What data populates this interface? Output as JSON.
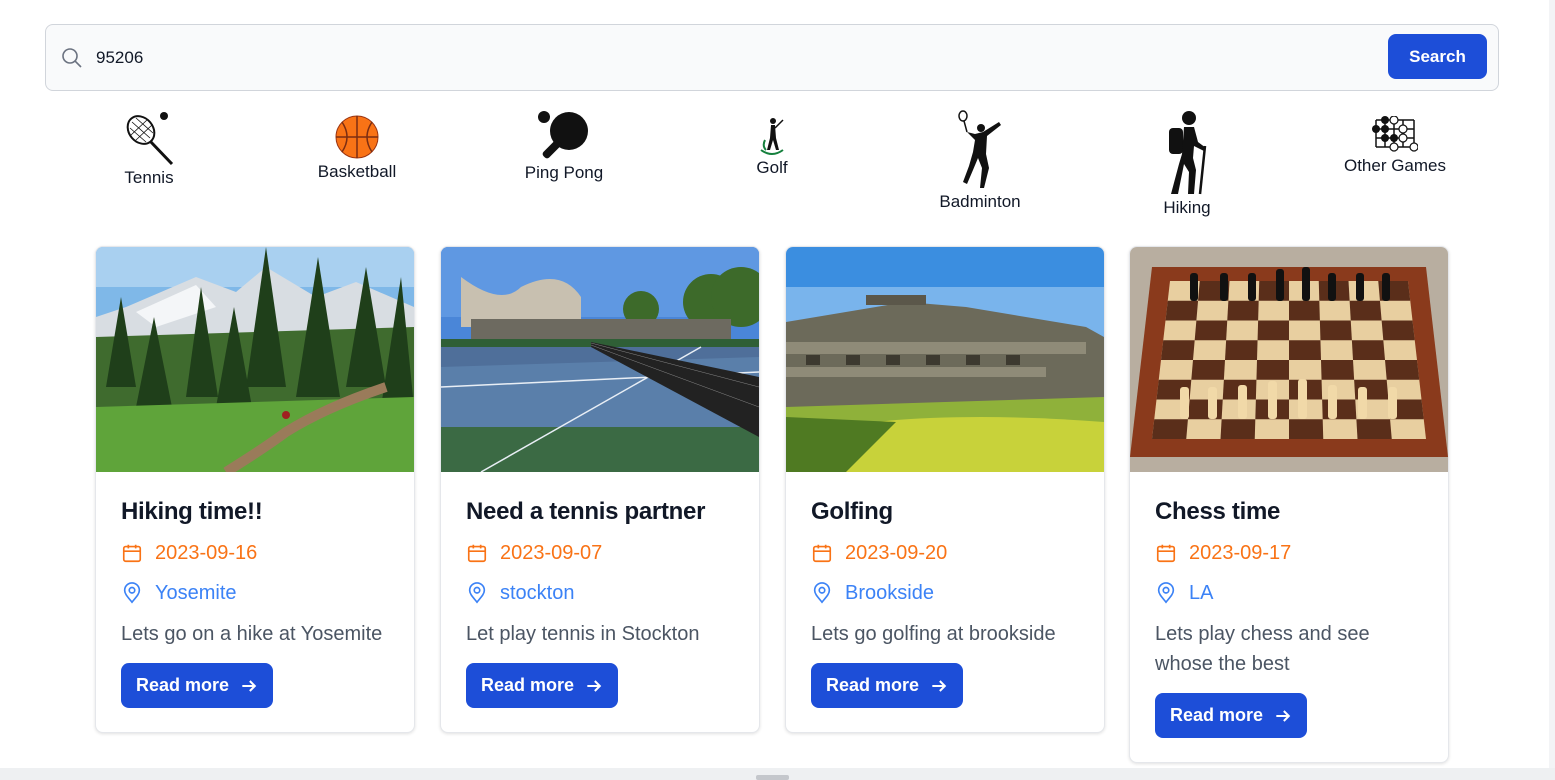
{
  "search": {
    "value": "95206",
    "button_label": "Search"
  },
  "categories": [
    {
      "label": "Tennis",
      "icon": "tennis-racket-icon"
    },
    {
      "label": "Basketball",
      "icon": "basketball-icon"
    },
    {
      "label": "Ping Pong",
      "icon": "ping-pong-paddle-icon"
    },
    {
      "label": "Golf",
      "icon": "golfer-icon"
    },
    {
      "label": "Badminton",
      "icon": "badminton-player-icon"
    },
    {
      "label": "Hiking",
      "icon": "hiker-icon"
    },
    {
      "label": "Other Games",
      "icon": "go-board-icon"
    }
  ],
  "cards": [
    {
      "title": "Hiking time!!",
      "date": "2023-09-16",
      "location": "Yosemite",
      "description": "Lets go on a hike at Yosemite",
      "button_label": "Read more",
      "image": "mountain-trail-photo"
    },
    {
      "title": "Need a tennis partner",
      "date": "2023-09-07",
      "location": "stockton",
      "description": "Let play tennis in Stockton",
      "button_label": "Read more",
      "image": "tennis-court-photo"
    },
    {
      "title": "Golfing",
      "date": "2023-09-20",
      "location": "Brookside",
      "description": "Lets go golfing at brookside",
      "button_label": "Read more",
      "image": "golf-clubhouse-photo"
    },
    {
      "title": "Chess time",
      "date": "2023-09-17",
      "location": "LA",
      "description": "Lets play chess and see whose the best",
      "button_label": "Read more",
      "image": "chess-board-photo"
    }
  ],
  "colors": {
    "primary": "#1d4ed8",
    "date": "#f97316",
    "location": "#3b82f6"
  }
}
